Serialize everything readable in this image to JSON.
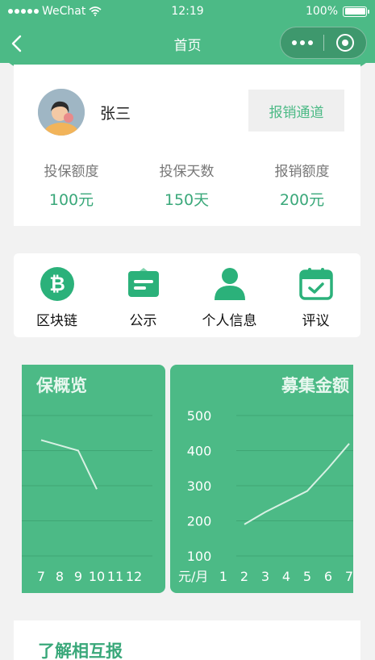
{
  "status_bar": {
    "carrier": "WeChat",
    "time": "12:19",
    "battery_percent": "100%",
    "battery_level": 1.0
  },
  "nav": {
    "title": "首页"
  },
  "profile": {
    "name": "张三",
    "claim_button": "报销通道",
    "stats": [
      {
        "label": "投保额度",
        "value": "100元"
      },
      {
        "label": "投保天数",
        "value": "150天"
      },
      {
        "label": "报销额度",
        "value": "200元"
      }
    ]
  },
  "menu": {
    "items": [
      {
        "label": "区块链",
        "icon": "bitcoin-icon"
      },
      {
        "label": "公示",
        "icon": "notice-card-icon"
      },
      {
        "label": "个人信息",
        "icon": "user-icon"
      },
      {
        "label": "评议",
        "icon": "calendar-check-icon"
      }
    ]
  },
  "colors": {
    "primary": "#4cba86",
    "accent_text": "#3aa87a",
    "background": "#f2f2f2"
  },
  "chart_data": [
    {
      "type": "line",
      "title": "保概览",
      "x": [
        7,
        8,
        9,
        10,
        11,
        12
      ],
      "x_visible_ticks": [
        "7",
        "8",
        "9",
        "10",
        "11",
        "12"
      ],
      "series": [
        {
          "values": [
            430,
            415,
            400,
            290,
            null,
            null
          ]
        }
      ],
      "ylim": [
        100,
        500
      ],
      "grid": true
    },
    {
      "type": "line",
      "title": "募集金额",
      "x_unit_label": "元/月",
      "x": [
        1,
        2,
        3,
        4,
        5,
        6,
        7
      ],
      "x_visible_ticks": [
        "1",
        "2",
        "3",
        "4",
        "5",
        "6",
        "7"
      ],
      "y_ticks": [
        "500",
        "400",
        "300",
        "200",
        "100"
      ],
      "series": [
        {
          "values": [
            null,
            190,
            225,
            255,
            285,
            350,
            420
          ]
        }
      ],
      "ylim": [
        100,
        500
      ],
      "grid": true
    }
  ],
  "about": {
    "title": "了解相互报"
  }
}
